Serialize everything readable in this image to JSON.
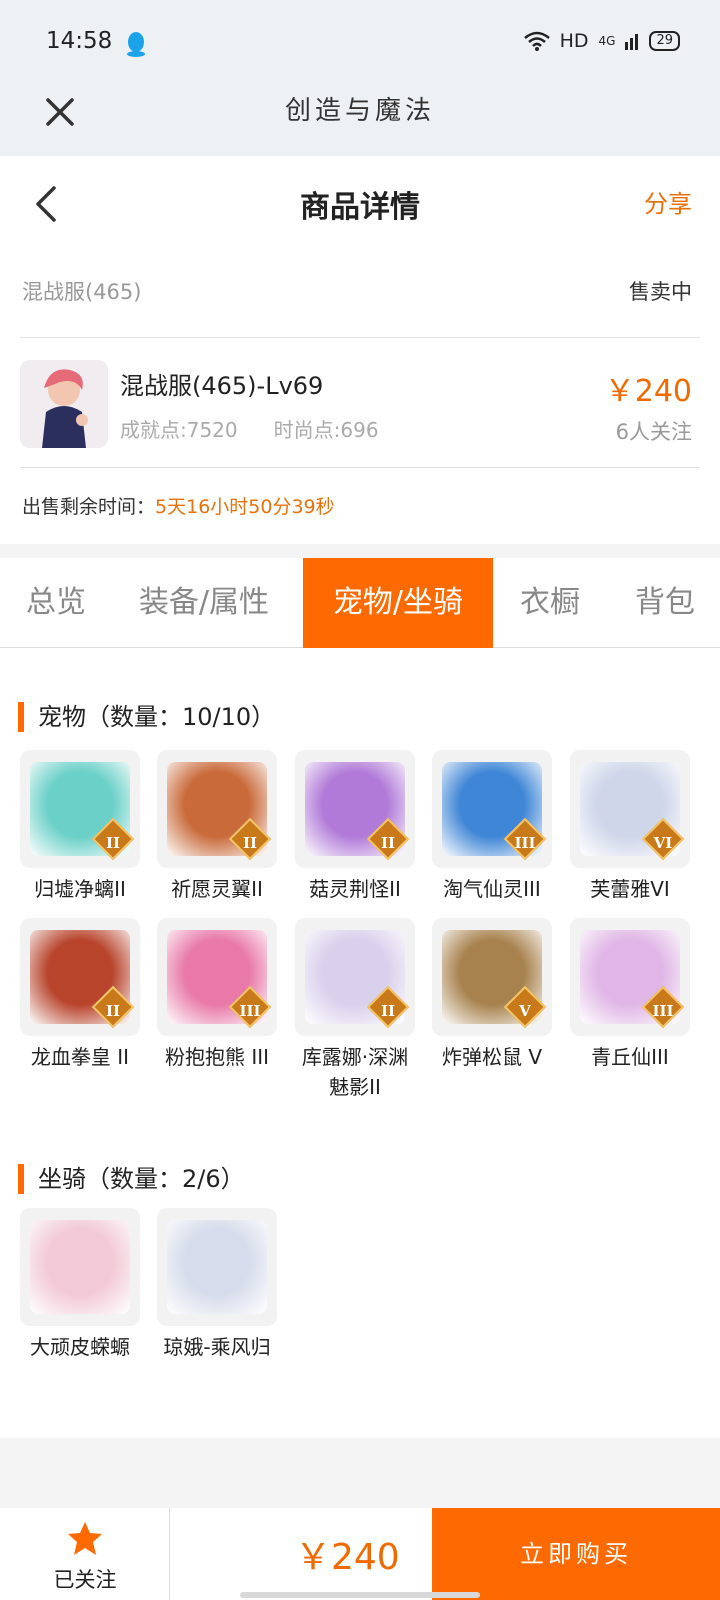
{
  "status": {
    "time": "14:58",
    "network": "HD",
    "signal": "4G",
    "battery": "29"
  },
  "app": {
    "title": "创造与魔法"
  },
  "nav": {
    "title": "商品详情",
    "share": "分享"
  },
  "listing": {
    "server": "混战服(465)",
    "status": "售卖中",
    "name": "混战服(465)-Lv69",
    "achievement": "成就点:7520",
    "fashion": "时尚点:696",
    "price": "￥240",
    "followers": "6人关注",
    "time_label": "出售剩余时间：",
    "time_value": "5天16小时50分39秒"
  },
  "tabs": [
    "总览",
    "装备/属性",
    "宠物/坐骑",
    "衣橱",
    "背包"
  ],
  "active_tab": 2,
  "pets": {
    "title": "宠物（数量：10/10）",
    "items": [
      {
        "name": "归墟净螭II",
        "grade": "II",
        "color": "#6ad0c8"
      },
      {
        "name": "祈愿灵翼II",
        "grade": "II",
        "color": "#c96a3a"
      },
      {
        "name": "菇灵荆怪II",
        "grade": "II",
        "color": "#b17ad8"
      },
      {
        "name": "淘气仙灵III",
        "grade": "III",
        "color": "#3f86d6"
      },
      {
        "name": "芙蕾雅VI",
        "grade": "VI",
        "color": "#cfd6ea"
      },
      {
        "name": "龙血拳皇 II",
        "grade": "II",
        "color": "#b8442c"
      },
      {
        "name": "粉抱抱熊 III",
        "grade": "III",
        "color": "#e879a8"
      },
      {
        "name": "库露娜·深渊魅影II",
        "grade": "II",
        "color": "#d9d0ec"
      },
      {
        "name": "炸弹松鼠 V",
        "grade": "V",
        "color": "#a8824e"
      },
      {
        "name": "青丘仙III",
        "grade": "III",
        "color": "#e0b6e6"
      }
    ]
  },
  "mounts": {
    "title": "坐骑（数量：2/6）",
    "items": [
      {
        "name": "大顽皮蝾螈",
        "color": "#f2c9d6"
      },
      {
        "name": "琼娥-乘风归",
        "color": "#d6dceb"
      }
    ]
  },
  "footer": {
    "follow_label": "已关注",
    "price": "￥240",
    "buy_label": "立即购买"
  },
  "colors": {
    "accent": "#ff6a00",
    "accent_text": "#e8710c"
  }
}
